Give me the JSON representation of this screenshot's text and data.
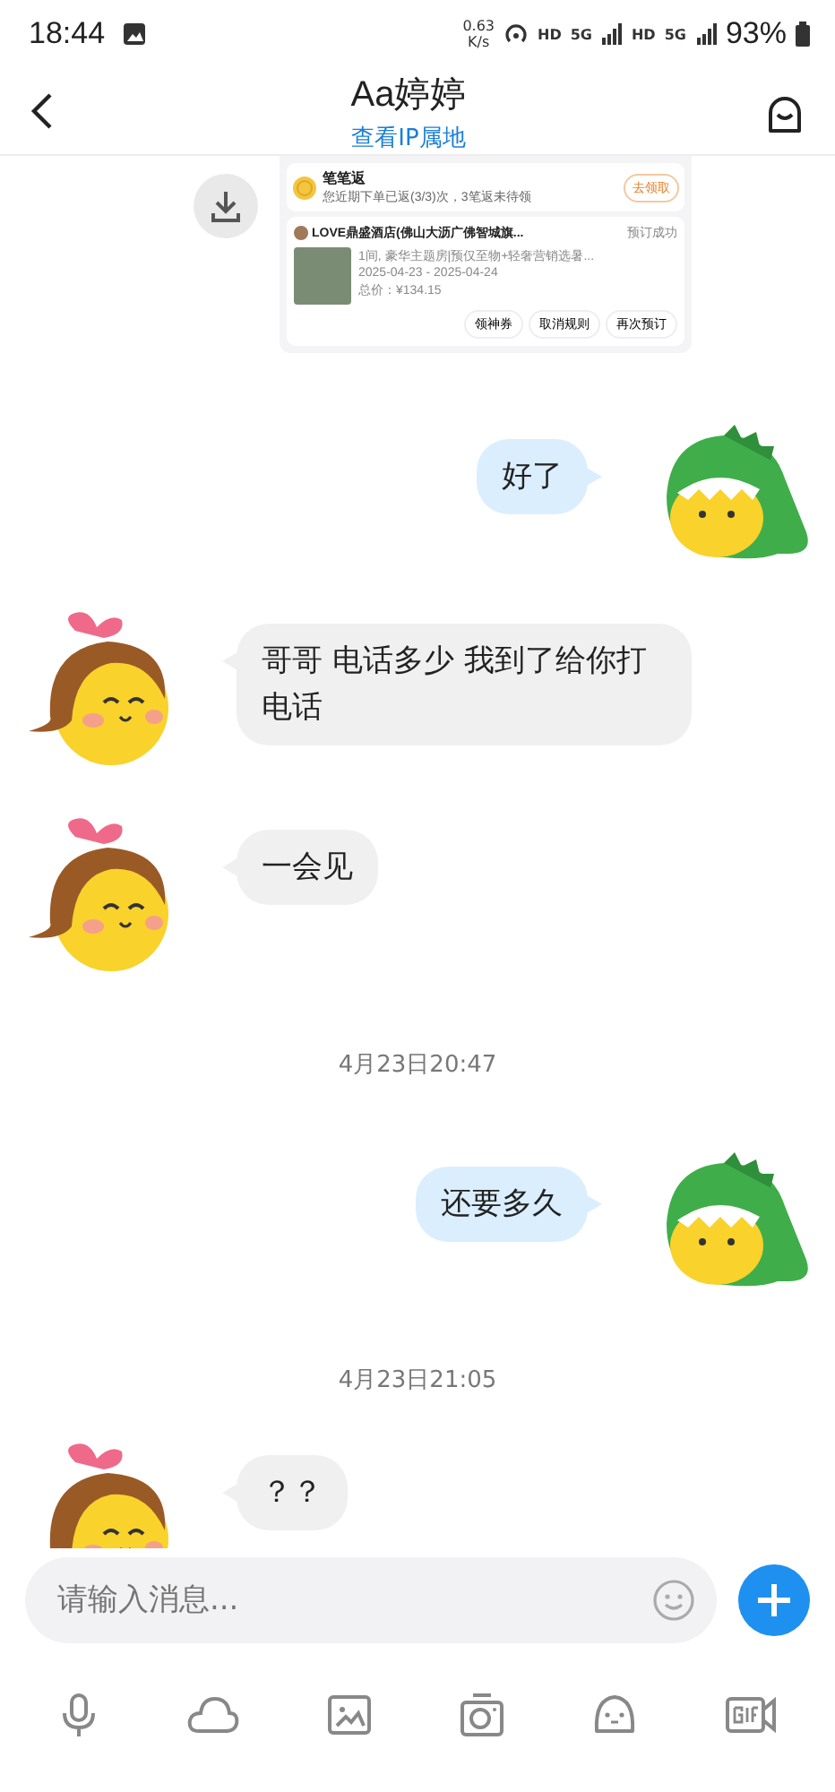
{
  "status_bar": {
    "time": "18:44",
    "speed_value": "0.63",
    "speed_unit": "K/s",
    "network_labels": [
      "HD",
      "5G",
      "HD",
      "5G"
    ],
    "battery": "93%"
  },
  "header": {
    "title": "Aa婷婷",
    "subtitle": "查看IP属地"
  },
  "messages": [
    {
      "kind": "card",
      "promo_title": "笔笔返",
      "promo_text": "您近期下单已返(3/3)次，3笔返未待领",
      "promo_button": "去领取",
      "hotel": "LOVE鼎盛酒店(佛山大沥广佛智城旗...",
      "status": "预订成功",
      "room": "1间, 豪华主题房|预仅至物+轻奢营销选暑...",
      "dates": "2025-04-23 - 2025-04-24",
      "price": "总价：¥134.15",
      "buttons": [
        "领神券",
        "取消规则",
        "再次预订"
      ]
    },
    {
      "kind": "text",
      "outgoing": true,
      "text": "好了"
    },
    {
      "kind": "text",
      "outgoing": false,
      "text": "哥哥 电话多少 我到了给你打电话"
    },
    {
      "kind": "text",
      "outgoing": false,
      "text": "一会见"
    },
    {
      "kind": "time",
      "text": "4月23日20:47"
    },
    {
      "kind": "text",
      "outgoing": true,
      "text": "还要多久"
    },
    {
      "kind": "time",
      "text": "4月23日21:05"
    },
    {
      "kind": "text",
      "outgoing": false,
      "text": "？？"
    }
  ],
  "composer": {
    "placeholder": "请输入消息..."
  }
}
